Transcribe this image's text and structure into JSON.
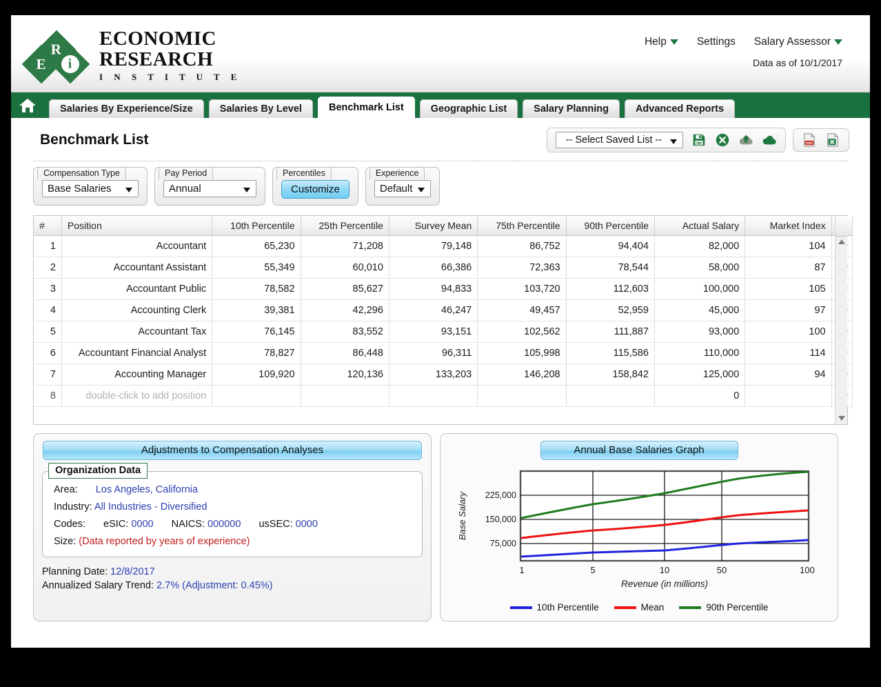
{
  "brand": {
    "name_line1": "ECONOMIC",
    "name_line2": "RESEARCH",
    "name_line3": "I N S T I T U T E",
    "mark_letters": [
      "R",
      "E",
      "i"
    ]
  },
  "header": {
    "help": "Help",
    "settings": "Settings",
    "product": "Salary Assessor",
    "data_as_of": "Data as of 10/1/2017"
  },
  "tabs": [
    {
      "label": "Salaries By Experience/Size",
      "active": false
    },
    {
      "label": "Salaries By Level",
      "active": false
    },
    {
      "label": "Benchmark List",
      "active": true
    },
    {
      "label": "Geographic List",
      "active": false
    },
    {
      "label": "Salary Planning",
      "active": false
    },
    {
      "label": "Advanced Reports",
      "active": false
    }
  ],
  "page": {
    "title": "Benchmark List"
  },
  "toolbar": {
    "saved_list_value": "-- Select Saved List --",
    "icons": [
      "save-icon",
      "delete-list-icon",
      "upload-icon",
      "download-icon",
      "pdf-export-icon",
      "excel-export-icon"
    ]
  },
  "filters": [
    {
      "label": "Compensation Type",
      "value": "Base Salaries",
      "type": "select"
    },
    {
      "label": "Pay Period",
      "value": "Annual",
      "type": "select"
    },
    {
      "label": "Percentiles",
      "value": "Customize",
      "type": "button"
    },
    {
      "label": "Experience",
      "value": "Default",
      "type": "select"
    }
  ],
  "table": {
    "columns": [
      "#",
      "Position",
      "10th Percentile",
      "25th Percentile",
      "Survey Mean",
      "75th Percentile",
      "90th Percentile",
      "Actual Salary",
      "Market Index"
    ],
    "delete_all_icon": "delete-all-icon",
    "rows": [
      {
        "num": "1",
        "position": "Accountant",
        "p10": "65,230",
        "p25": "71,208",
        "mean": "79,148",
        "p75": "86,752",
        "p90": "94,404",
        "actual": "82,000",
        "index": "104"
      },
      {
        "num": "2",
        "position": "Accountant Assistant",
        "p10": "55,349",
        "p25": "60,010",
        "mean": "66,386",
        "p75": "72,363",
        "p90": "78,544",
        "actual": "58,000",
        "index": "87"
      },
      {
        "num": "3",
        "position": "Accountant Public",
        "p10": "78,582",
        "p25": "85,627",
        "mean": "94,833",
        "p75": "103,720",
        "p90": "112,603",
        "actual": "100,000",
        "index": "105"
      },
      {
        "num": "4",
        "position": "Accounting Clerk",
        "p10": "39,381",
        "p25": "42,296",
        "mean": "46,247",
        "p75": "49,457",
        "p90": "52,959",
        "actual": "45,000",
        "index": "97"
      },
      {
        "num": "5",
        "position": "Accountant Tax",
        "p10": "76,145",
        "p25": "83,552",
        "mean": "93,151",
        "p75": "102,562",
        "p90": "111,887",
        "actual": "93,000",
        "index": "100"
      },
      {
        "num": "6",
        "position": "Accountant Financial Analyst",
        "p10": "78,827",
        "p25": "86,448",
        "mean": "96,311",
        "p75": "105,998",
        "p90": "115,586",
        "actual": "110,000",
        "index": "114"
      },
      {
        "num": "7",
        "position": "Accounting Manager",
        "p10": "109,920",
        "p25": "120,136",
        "mean": "133,203",
        "p75": "146,208",
        "p90": "158,842",
        "actual": "125,000",
        "index": "94",
        "actual_highlighted": true
      },
      {
        "num": "8",
        "position": "double-click to add position",
        "p10": "",
        "p25": "",
        "mean": "",
        "p75": "",
        "p90": "",
        "actual": "0",
        "index": "",
        "placeholder": true
      }
    ]
  },
  "adjustments": {
    "panel_title": "Adjustments to Compensation Analyses",
    "legend": "Organization Data",
    "area_label": "Area:",
    "area_value": "Los Angeles, California",
    "industry_label": "Industry:",
    "industry_value": "All Industries - Diversified",
    "codes_label": "Codes:",
    "esic_label": "eSIC:",
    "esic_value": "0000",
    "naics_label": "NAICS:",
    "naics_value": "000000",
    "ussec_label": "usSEC:",
    "ussec_value": "0000",
    "size_label": "Size:",
    "size_value": "(Data reported by years of experience)",
    "planning_date_label": "Planning Date:",
    "planning_date_value": "12/8/2017",
    "trend_label": "Annualized Salary Trend:",
    "trend_value": "2.7% (Adjustment: 0.45%)"
  },
  "graph_panel": {
    "panel_title": "Annual Base Salaries Graph"
  },
  "chart_data": {
    "type": "line",
    "title": "Annual Base Salaries Graph",
    "xlabel": "Revenue (in millions)",
    "ylabel": "Base Salary",
    "x_scale": "log",
    "x_ticks": [
      1,
      5,
      10,
      50,
      100
    ],
    "x_tick_labels": [
      "1",
      "5",
      "10",
      "50",
      "100"
    ],
    "y_ticks": [
      75000,
      150000,
      225000
    ],
    "y_tick_labels": [
      "75,000",
      "150,000",
      "225,000"
    ],
    "ylim": [
      30000,
      290000
    ],
    "xlim": [
      1,
      100
    ],
    "grid": true,
    "legend_position": "bottom",
    "series": [
      {
        "name": "10th Percentile",
        "color": "#2222dd",
        "x": [
          1,
          2,
          5,
          10,
          20,
          50,
          100
        ],
        "values": [
          43000,
          47000,
          52000,
          55000,
          61000,
          74000,
          80000
        ]
      },
      {
        "name": "Mean",
        "color": "#ee1111",
        "x": [
          1,
          2,
          5,
          10,
          20,
          50,
          100
        ],
        "values": [
          102000,
          112000,
          123000,
          130000,
          142000,
          158000,
          168000
        ]
      },
      {
        "name": "90th Percentile",
        "color": "#1d7d1d",
        "x": [
          1,
          2,
          5,
          10,
          20,
          50,
          100
        ],
        "values": [
          165000,
          184000,
          202000,
          213000,
          236000,
          262000,
          278000
        ]
      }
    ]
  },
  "colors": {
    "brand_green": "#1b7040",
    "accent_blue": "#7fd0f3",
    "link_blue": "#2b3fb0",
    "alert_red": "#c01f1f"
  }
}
